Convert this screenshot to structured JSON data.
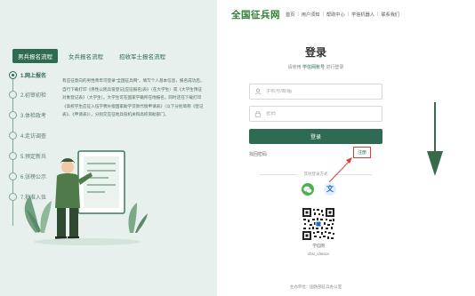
{
  "left_panel": {
    "tabs": [
      {
        "label": "男兵报名流程",
        "active": true
      },
      {
        "label": "女兵报名流程",
        "active": false
      },
      {
        "label": "招收军士报名流程",
        "active": false
      }
    ],
    "steps": [
      {
        "label": "1.网上报名",
        "active": true
      },
      {
        "label": "2.初审初检",
        "active": false
      },
      {
        "label": "3.体检政考",
        "active": false
      },
      {
        "label": "4.走访调查",
        "active": false
      },
      {
        "label": "5.预定新兵",
        "active": false
      },
      {
        "label": "6.张榜公示",
        "active": false
      },
      {
        "label": "7.批准入伍",
        "active": false
      }
    ],
    "description": "有应征意向的男性青年可登录\"全国征兵网\"，填写个人基本信息，报名成功后，自行下载打印《男性公民兵役登记(应征报名)表》（在大学生）或《大学生预征对象登记表》（大学生）。大学生可在国家学籍所在地报名，同时还在下载打印《高校学生应征入伍学费补偿国家助学贷款代偿申请表》（以下分别简称《登记表》、《申请表》），分别交应征地兵役机关和高校资助部门。"
  },
  "header": {
    "logo": "全国征兵网",
    "nav": [
      "首页",
      "用户须知",
      "帮助中心",
      "学信机器人",
      "联系我们"
    ]
  },
  "login": {
    "title": "登录",
    "subtitle_prefix": "请使用",
    "subtitle_highlight": "学信网账号",
    "subtitle_suffix": "进行登录",
    "phone_placeholder": "手机号/邮箱",
    "password_placeholder": "密码",
    "login_button": "登录",
    "forgot_link": "找回密码",
    "register_link": "注册",
    "other_methods_label": "其他登录方式",
    "qr_label": "学信网",
    "qr_id": "chsi_chescc"
  },
  "footer": {
    "text": "主办单位：国防部征兵办公室"
  },
  "colors": {
    "brand_green": "#2e6b52",
    "panel_bg": "#e7f0ec",
    "highlight_red": "#e53935",
    "annotation_arrow": "#3a6b48"
  },
  "icons": {
    "phone_field": "user-icon",
    "password_field": "lock-icon",
    "oauth_wechat": "wechat-icon",
    "oauth_xuexin": "xuexin-icon"
  }
}
